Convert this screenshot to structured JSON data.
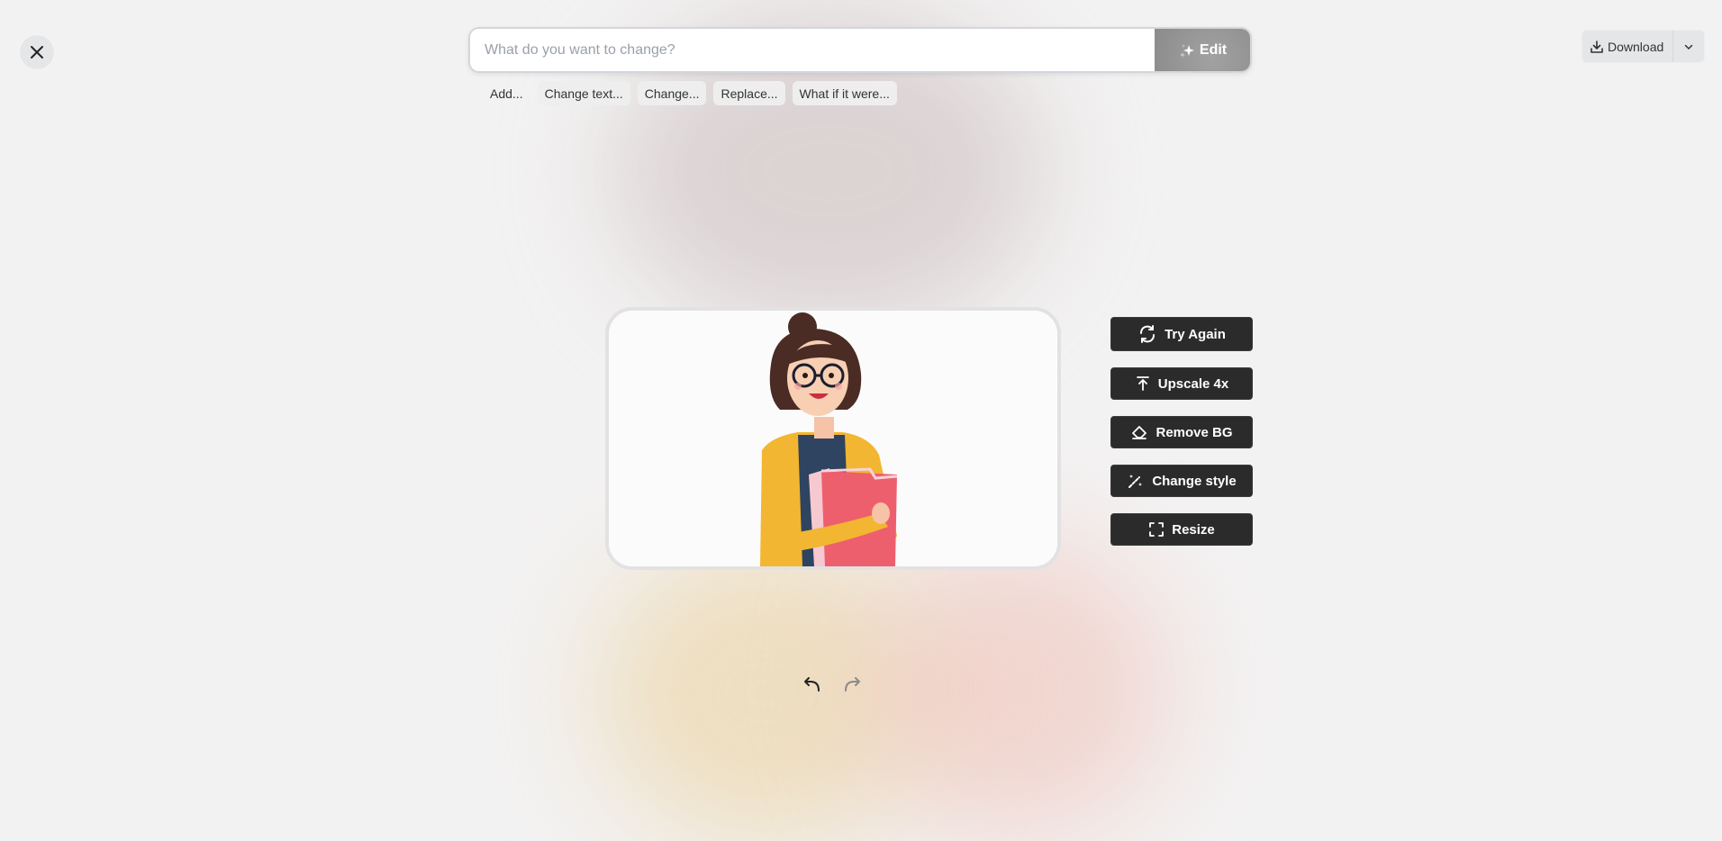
{
  "close": {
    "icon": "close-icon"
  },
  "prompt": {
    "placeholder": "What do you want to change?",
    "value": "",
    "edit_label": "Edit",
    "edit_icon": "sparkle-icon"
  },
  "suggestions": [
    "Add...",
    "Change text...",
    "Change...",
    "Replace...",
    "What if it were..."
  ],
  "download": {
    "label": "Download",
    "icon": "download-icon",
    "menu_icon": "chevron-down-icon"
  },
  "canvas": {
    "image_alt": "Illustration of a smiling woman with glasses and a hair bun, wearing a yellow cardigan, holding pink folders"
  },
  "actions": [
    {
      "label": "Try Again",
      "icon": "refresh-icon"
    },
    {
      "label": "Upscale 4x",
      "icon": "upscale-icon"
    },
    {
      "label": "Remove BG",
      "icon": "eraser-icon"
    },
    {
      "label": "Change style",
      "icon": "magic-wand-icon"
    },
    {
      "label": "Resize",
      "icon": "resize-icon"
    }
  ],
  "history": {
    "undo_icon": "undo-icon",
    "redo_icon": "redo-icon",
    "redo_enabled": false
  },
  "colors": {
    "action_bg": "#2b2b2b",
    "edit_bg": "#8b8b8b",
    "page_bg": "#f3f2f2"
  }
}
